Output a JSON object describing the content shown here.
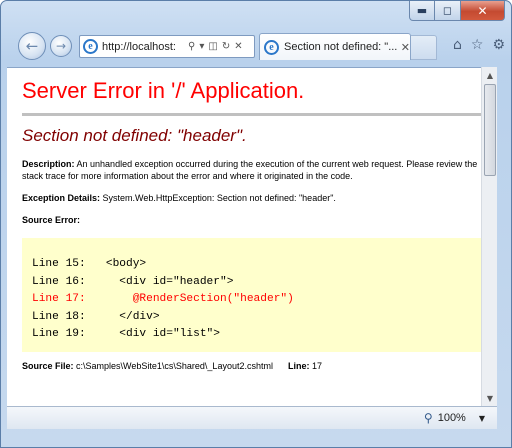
{
  "browser": {
    "address": "http://localhost:",
    "tab_title": "Section not defined: \"...",
    "zoom": "100%"
  },
  "page": {
    "heading": "Server Error in '/' Application.",
    "error_title": "Section not defined: \"header\".",
    "description_label": "Description:",
    "description_text": "An unhandled exception occurred during the execution of the current web request. Please review the stack trace for more information about the error and where it originated in the code.",
    "exception_label": "Exception Details:",
    "exception_text": "System.Web.HttpException: Section not defined: \"header\".",
    "source_error_label": "Source Error:",
    "code_lines": [
      "Line 15:   <body>",
      "Line 16:     <div id=\"header\">",
      "Line 17:       @RenderSection(\"header\")",
      "Line 18:     </div>",
      "Line 19:     <div id=\"list\">"
    ],
    "source_file_label": "Source File:",
    "source_file_path": "c:\\Samples\\WebSite1\\cs\\Shared\\_Layout2.cshtml",
    "line_label": "Line:",
    "line_number": "17"
  },
  "colors": {
    "heading": "#ff0000",
    "error_title": "#800000",
    "code_background": "#ffffcc",
    "error_line": "#ff0000"
  }
}
